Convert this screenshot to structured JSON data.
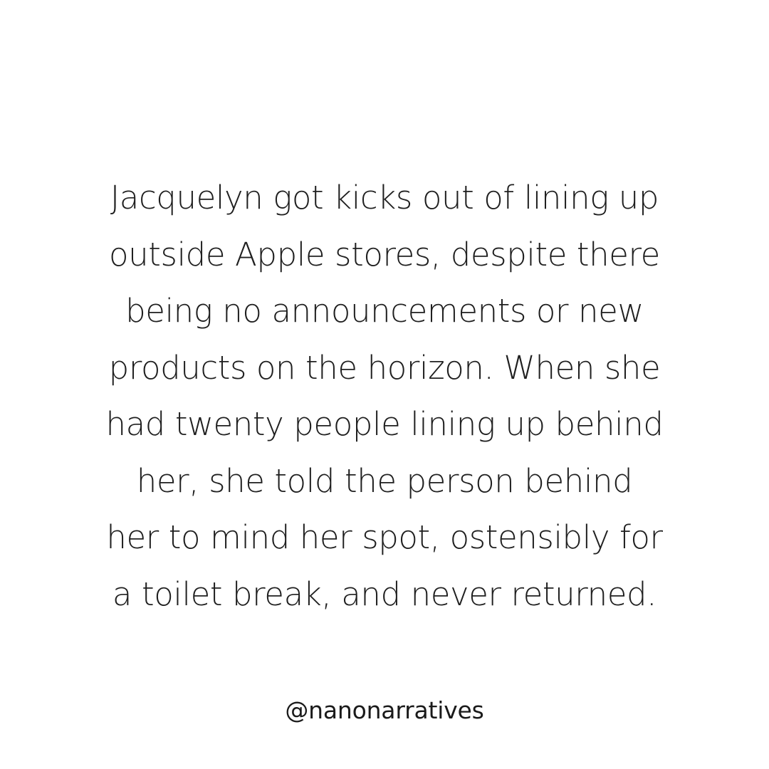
{
  "post": {
    "background": "#ffffff",
    "text_color": "#1f1f1f",
    "story_lines": [
      "Jacquelyn got kicks out of lining up",
      "outside Apple stores, despite there",
      "being no announcements or new",
      "products on the horizon. When she",
      "had twenty people lining up behind",
      "her, she told the person behind",
      "her to mind her spot, ostensibly for",
      "a toilet break, and never returned."
    ],
    "handle": "@nanonarratives"
  }
}
